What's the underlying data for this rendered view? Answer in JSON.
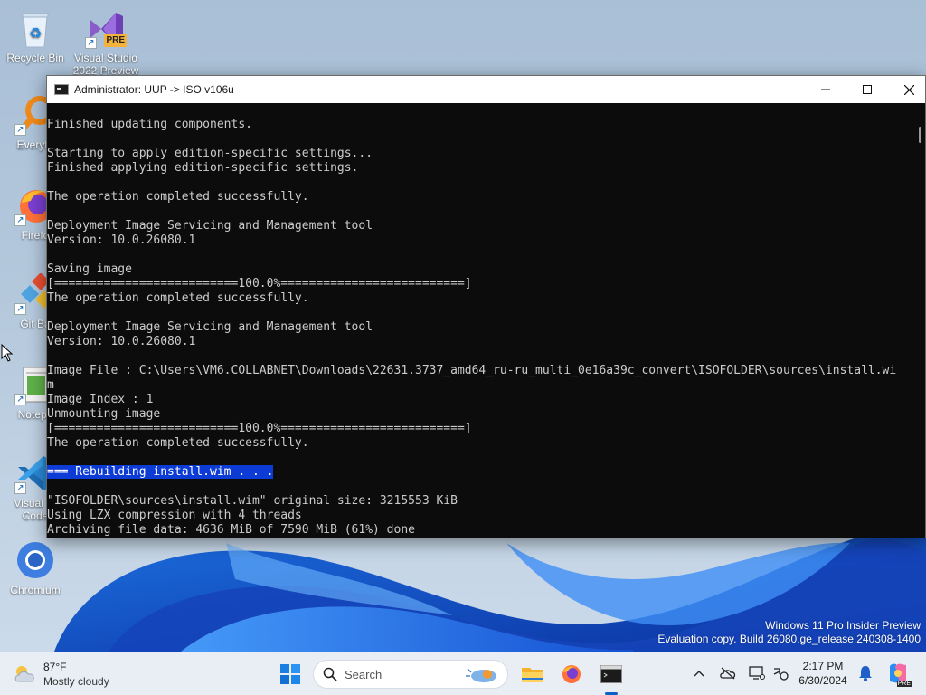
{
  "desktop": {
    "icons": [
      {
        "label": "Recycle Bin",
        "icon": "recycle-bin-icon"
      },
      {
        "label": "Visual Studio 2022 Preview",
        "badge": "PRE",
        "icon": "visual-studio-preview-icon"
      },
      {
        "label": "Everyth",
        "icon": "everything-search-icon"
      },
      {
        "label": "Firefo",
        "icon": "firefox-icon"
      },
      {
        "label": "Git Ba",
        "icon": "git-bash-icon"
      },
      {
        "label": "Notepa",
        "icon": "notepad-icon"
      },
      {
        "label": "Visual St Code",
        "icon": "vscode-icon"
      },
      {
        "label": "Chromium",
        "icon": "chromium-icon"
      }
    ],
    "watermark": {
      "line1": "Windows 11 Pro Insider Preview",
      "line2": "Evaluation copy. Build 26080.ge_release.240308-1400"
    }
  },
  "window": {
    "title": "Administrator:  UUP -> ISO v106u",
    "controls": {
      "minimize": "—",
      "maximize": "☐",
      "close": "✕"
    }
  },
  "console": {
    "lines": [
      "Finished updating components.",
      "",
      "Starting to apply edition-specific settings...",
      "Finished applying edition-specific settings.",
      "",
      "The operation completed successfully.",
      "",
      "Deployment Image Servicing and Management tool",
      "Version: 10.0.26080.1",
      "",
      "Saving image",
      "[==========================100.0%==========================]",
      "The operation completed successfully.",
      "",
      "Deployment Image Servicing and Management tool",
      "Version: 10.0.26080.1",
      "",
      "Image File : C:\\Users\\VM6.COLLABNET\\Downloads\\22631.3737_amd64_ru-ru_multi_0e16a39c_convert\\ISOFOLDER\\sources\\install.wi",
      "m",
      "Image Index : 1",
      "Unmounting image",
      "[==========================100.0%==========================]",
      "The operation completed successfully.",
      "",
      "=== Rebuilding install.wim . . .",
      "",
      "\"ISOFOLDER\\sources\\install.wim\" original size: 3215553 KiB",
      "Using LZX compression with 4 threads",
      "Archiving file data: 4636 MiB of 7590 MiB (61%) done"
    ],
    "highlighted_line": 24
  },
  "taskbar": {
    "weather": {
      "temp": "87°F",
      "condition": "Mostly cloudy"
    },
    "search_label": "Search",
    "clock": {
      "time": "2:17 PM",
      "date": "6/30/2024"
    },
    "tray": [
      "chevron-up-icon",
      "onedrive-offline-icon",
      "display-icon",
      "accessibility-icon",
      "notification-bell-icon",
      "copilot-icon"
    ],
    "pinned": [
      "start-icon",
      "file-explorer-icon",
      "firefox-icon",
      "terminal-icon"
    ]
  },
  "colors": {
    "console_bg": "#0c0c0c",
    "console_fg": "#cccccc",
    "selection": "#0c3bd6",
    "taskbar": "#e8eef4"
  }
}
